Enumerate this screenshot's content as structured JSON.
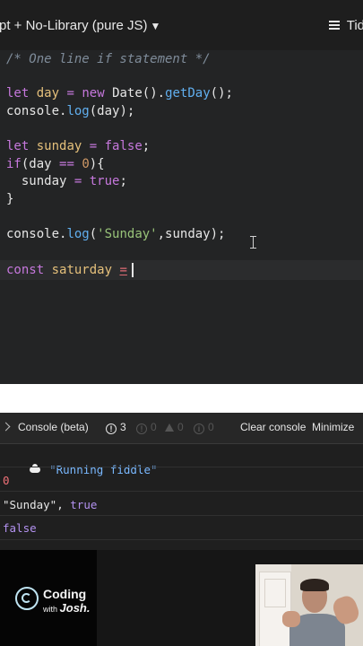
{
  "header": {
    "library_selector": "pt + No-Library (pure JS)",
    "tidy_label": "Tid"
  },
  "editor": {
    "lines": [
      "/* One line if statement */",
      "let day = new Date().getDay();",
      "console.log(day);",
      "let sunday = false;",
      "if(day == 0){",
      "  sunday = true;",
      "}",
      "console.log('Sunday',sunday);",
      "const saturday = "
    ]
  },
  "console": {
    "title": "Console (beta)",
    "error_count": "3",
    "warn_count": "0",
    "info_count": "0",
    "log_count": "0",
    "clear_label": "Clear console",
    "minimize_label": "Minimize",
    "output": [
      "\"Running fiddle\"",
      "0",
      "\"Sunday\"",
      ", ",
      "true",
      "false"
    ]
  },
  "branding": {
    "name": "Coding",
    "with": "with",
    "author": "Josh."
  },
  "colors": {
    "keyword": "#c678dd",
    "variable": "#e5c07b",
    "function": "#61afef",
    "string": "#98c379",
    "number": "#d19a66",
    "comment": "#7f8c9a",
    "console_string": "#98c379",
    "console_bool": "#b392f0",
    "console_number": "#f07178"
  }
}
